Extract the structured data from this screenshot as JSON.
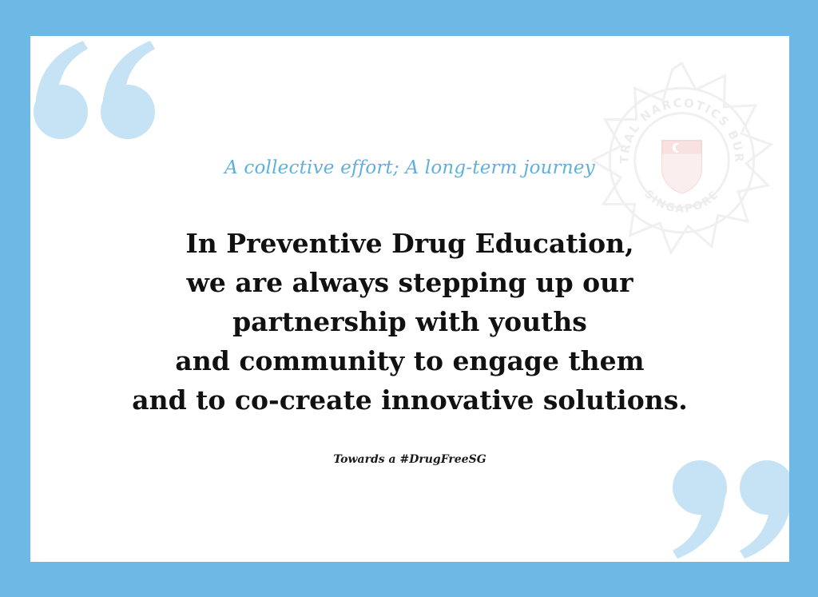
{
  "subtitle": "A collective effort; A long-term journey",
  "quote_lines": [
    "In Preventive Drug Education,",
    "we are always stepping up our",
    "partnership with youths",
    "and community to engage them",
    "and to co-create innovative solutions."
  ],
  "tagline": "Towards a #DrugFreeSG",
  "emblem": {
    "icon": "central-narcotics-bureau-emblem-icon",
    "text_top": "CENTRAL NARCOTICS BUREAU",
    "text_bottom": "SINGAPORE"
  },
  "colors": {
    "frame": "#6db8e4",
    "quote_marks": "#c6e2f5",
    "subtitle": "#5fb0de",
    "text": "#111111"
  }
}
